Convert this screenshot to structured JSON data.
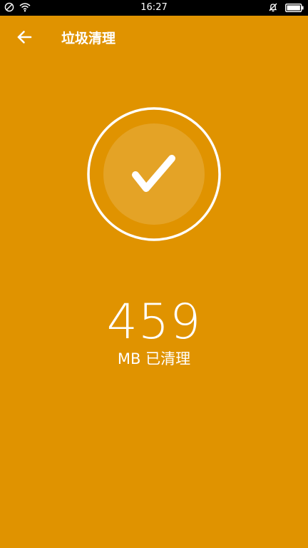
{
  "status_bar": {
    "time": "16:27",
    "left_icons": [
      "do-not-disturb-icon",
      "wifi-icon"
    ],
    "right_icons": [
      "alarm-off-icon",
      "battery-icon"
    ]
  },
  "app_bar": {
    "back_icon": "arrow-left-icon",
    "title": "垃圾清理"
  },
  "result": {
    "icon": "checkmark-icon",
    "value": "459",
    "caption": "MB 已清理"
  },
  "colors": {
    "background": "#E09300",
    "foreground": "#FFFFFF",
    "status_bar": "#000000"
  }
}
